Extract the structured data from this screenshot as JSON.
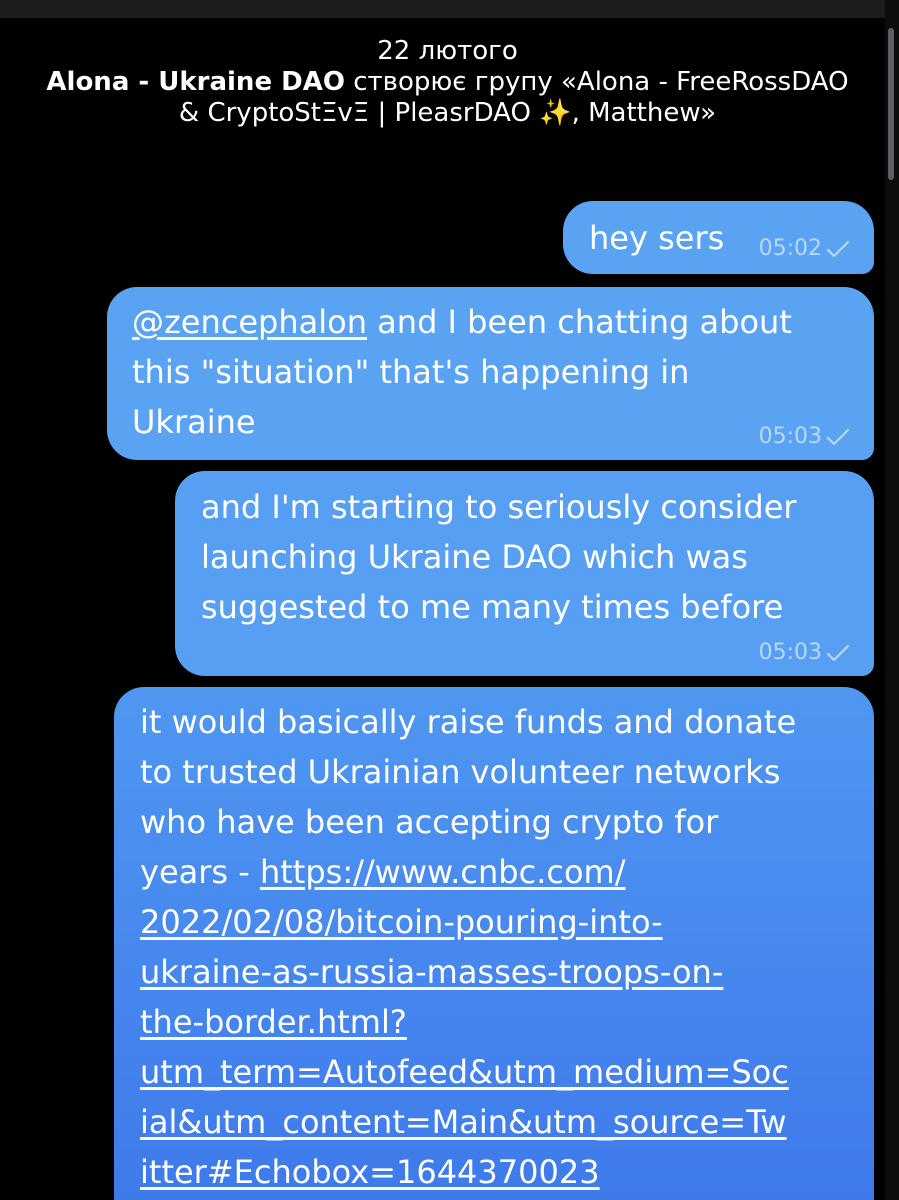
{
  "header": {
    "date": "22 лютого",
    "actor": "Alona - Ukraine DAO",
    "action": " створює групу «Alona - FreeRossDAO & CryptoStΞvΞ | PleasrDAO ✨, Matthew»"
  },
  "messages": [
    {
      "text": "hey sers",
      "time": "05:02",
      "status": "check-icon"
    },
    {
      "mention": "@zencephalon",
      "text": " and I been chatting about\nthis \"situation\" that's happening in\nUkraine",
      "time": "05:03",
      "status": "check-icon"
    },
    {
      "text": "and I'm starting to seriously consider\nlaunching Ukraine DAO which was\nsuggested to me many times before",
      "time": "05:03",
      "status": "check-icon"
    },
    {
      "text": "it would basically raise funds and donate\nto trusted Ukrainian volunteer networks\nwho have been accepting crypto for\nyears - ",
      "link": "https://www.cnbc.com/\n2022/02/08/bitcoin-pouring-into-\nukraine-as-russia-masses-troops-on-\nthe-border.html?\nutm_term=Autofeed&utm_medium=Soc\nial&utm_content=Main&utm_source=Tw\nitter#Echobox=1644370023"
    }
  ],
  "colors": {
    "background": "#000000",
    "bubble": "#5aa3f2",
    "bubble_dark": "#3d79ea",
    "meta": "#b9d8fb"
  }
}
